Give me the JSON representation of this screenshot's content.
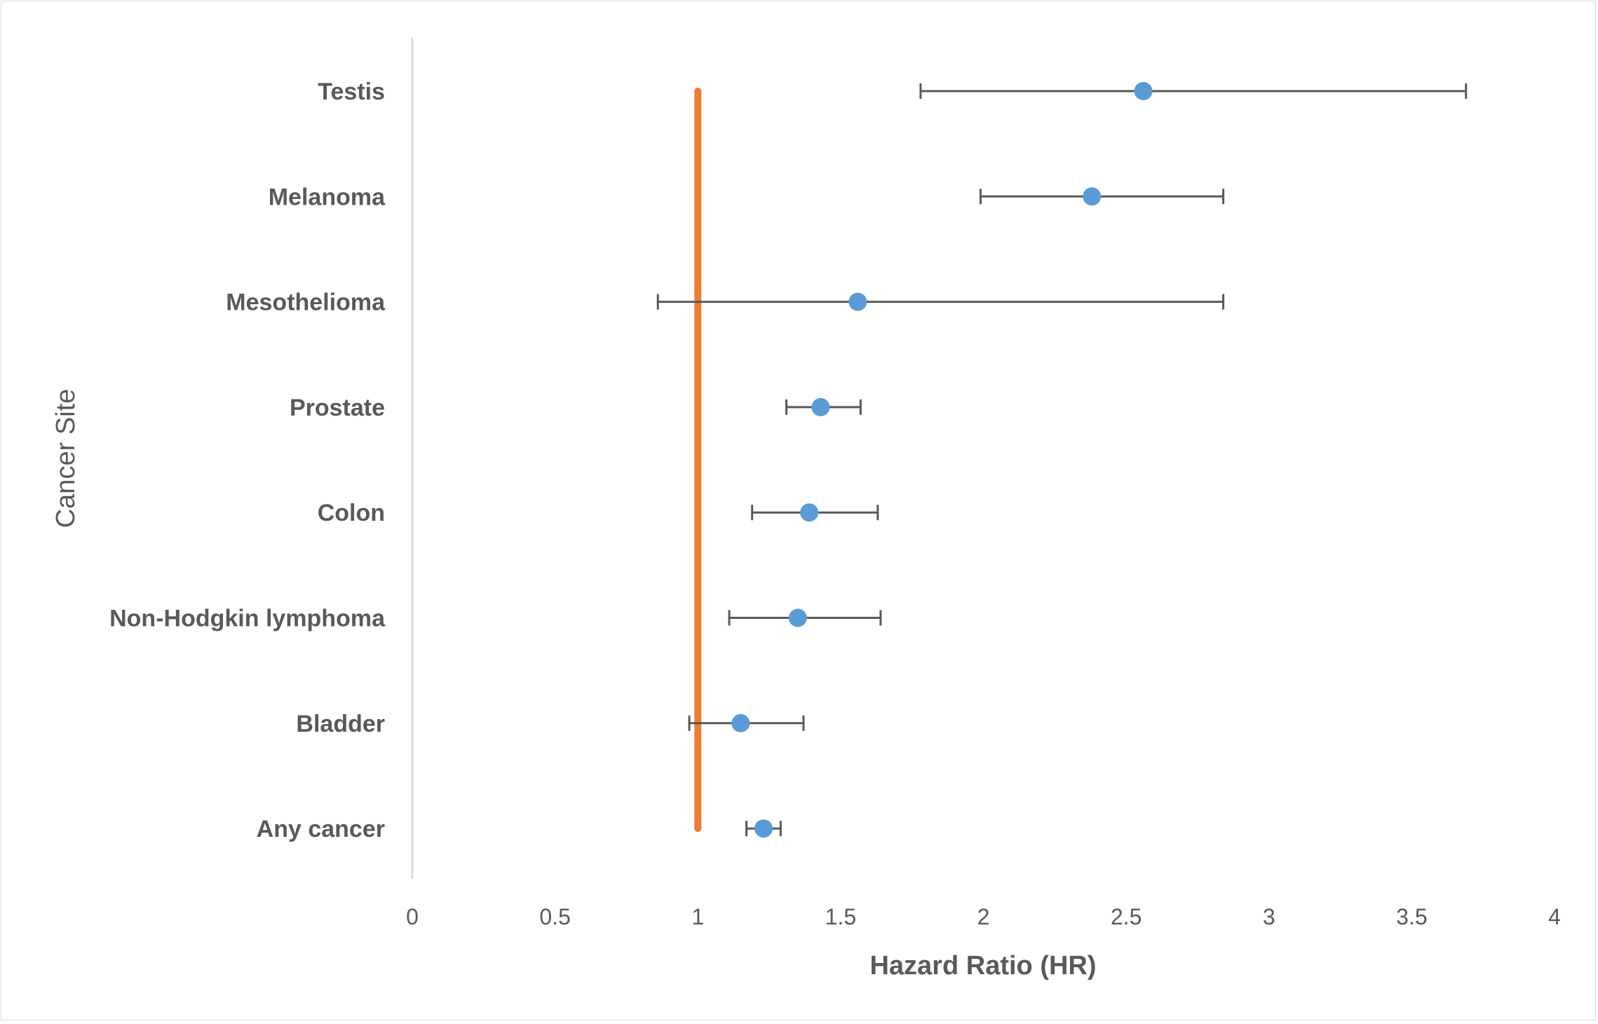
{
  "chart_data": {
    "type": "scatter",
    "subtype": "forest-plot",
    "title": "",
    "xlabel": "Hazard Ratio (HR)",
    "ylabel": "Cancer Site",
    "xlim": [
      0,
      4
    ],
    "xticks": [
      "0",
      "0.5",
      "1",
      "1.5",
      "2",
      "2.5",
      "3",
      "3.5",
      "4"
    ],
    "xtick_values": [
      0,
      0.5,
      1,
      1.5,
      2,
      2.5,
      3,
      3.5,
      4
    ],
    "grid": false,
    "legend": "none",
    "reference_line": {
      "x": 1,
      "color": "#ED7D31"
    },
    "point_color": "#5B9BD5",
    "errorbar_color": "#595959",
    "categories": [
      "Testis",
      "Melanoma",
      "Mesothelioma",
      "Prostate",
      "Colon",
      "Non-Hodgkin lymphoma",
      "Bladder",
      "Any cancer"
    ],
    "series": [
      {
        "name": "Hazard Ratio",
        "hr": [
          2.56,
          2.38,
          1.56,
          1.43,
          1.39,
          1.35,
          1.15,
          1.23
        ],
        "lower": [
          1.78,
          1.99,
          0.86,
          1.31,
          1.19,
          1.11,
          0.97,
          1.17
        ],
        "upper": [
          3.69,
          2.84,
          2.84,
          1.57,
          1.63,
          1.64,
          1.37,
          1.29
        ]
      }
    ]
  }
}
